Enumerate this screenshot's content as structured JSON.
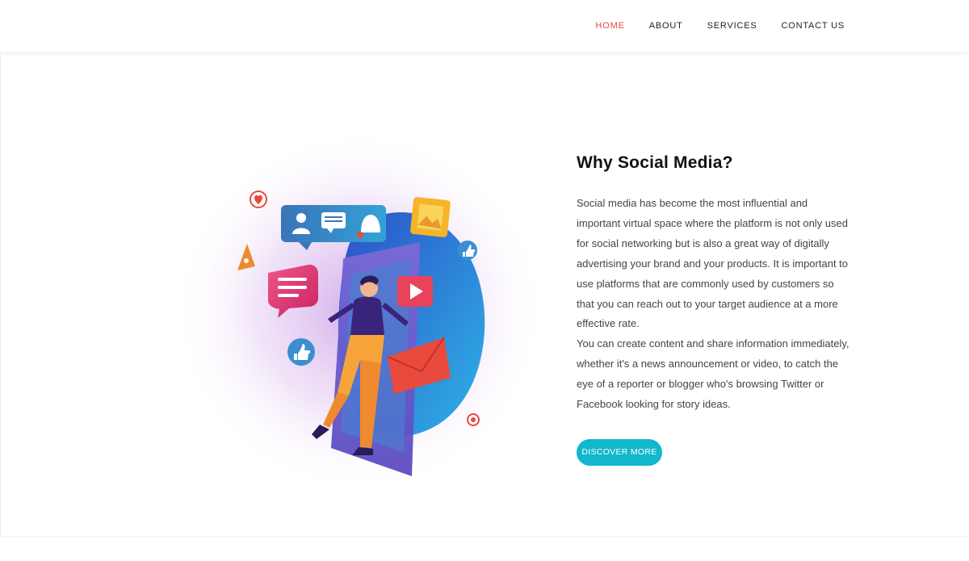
{
  "nav": {
    "items": [
      {
        "label": "HOME",
        "active": true
      },
      {
        "label": "ABOUT",
        "active": false
      },
      {
        "label": "SERVICES",
        "active": false
      },
      {
        "label": "CONTACT US",
        "active": false
      }
    ]
  },
  "section": {
    "title": "Why Social Media?",
    "paragraph_1": "Social media has become the most influential and important virtual space where the platform is not only used for social networking but is also a great way of digitally advertising your brand and your products. It is important to use platforms that are commonly used by customers so that you can reach out to your target audience at a more effective rate.",
    "paragraph_2": "You can create content and share information immediately, whether it's a news announcement or video, to catch the eye of a reporter or blogger who's browsing Twitter or Facebook looking for story ideas.",
    "button_label": "DISCOVER MORE"
  },
  "colors": {
    "accent_nav": "#e8473d",
    "button": "#12b7cc"
  },
  "illustration": {
    "icons": [
      "heart-icon",
      "music-note-icon",
      "user-icon",
      "chat-icon",
      "bell-icon",
      "image-icon",
      "thumbs-up-icon",
      "play-icon",
      "mail-icon",
      "record-icon"
    ]
  }
}
